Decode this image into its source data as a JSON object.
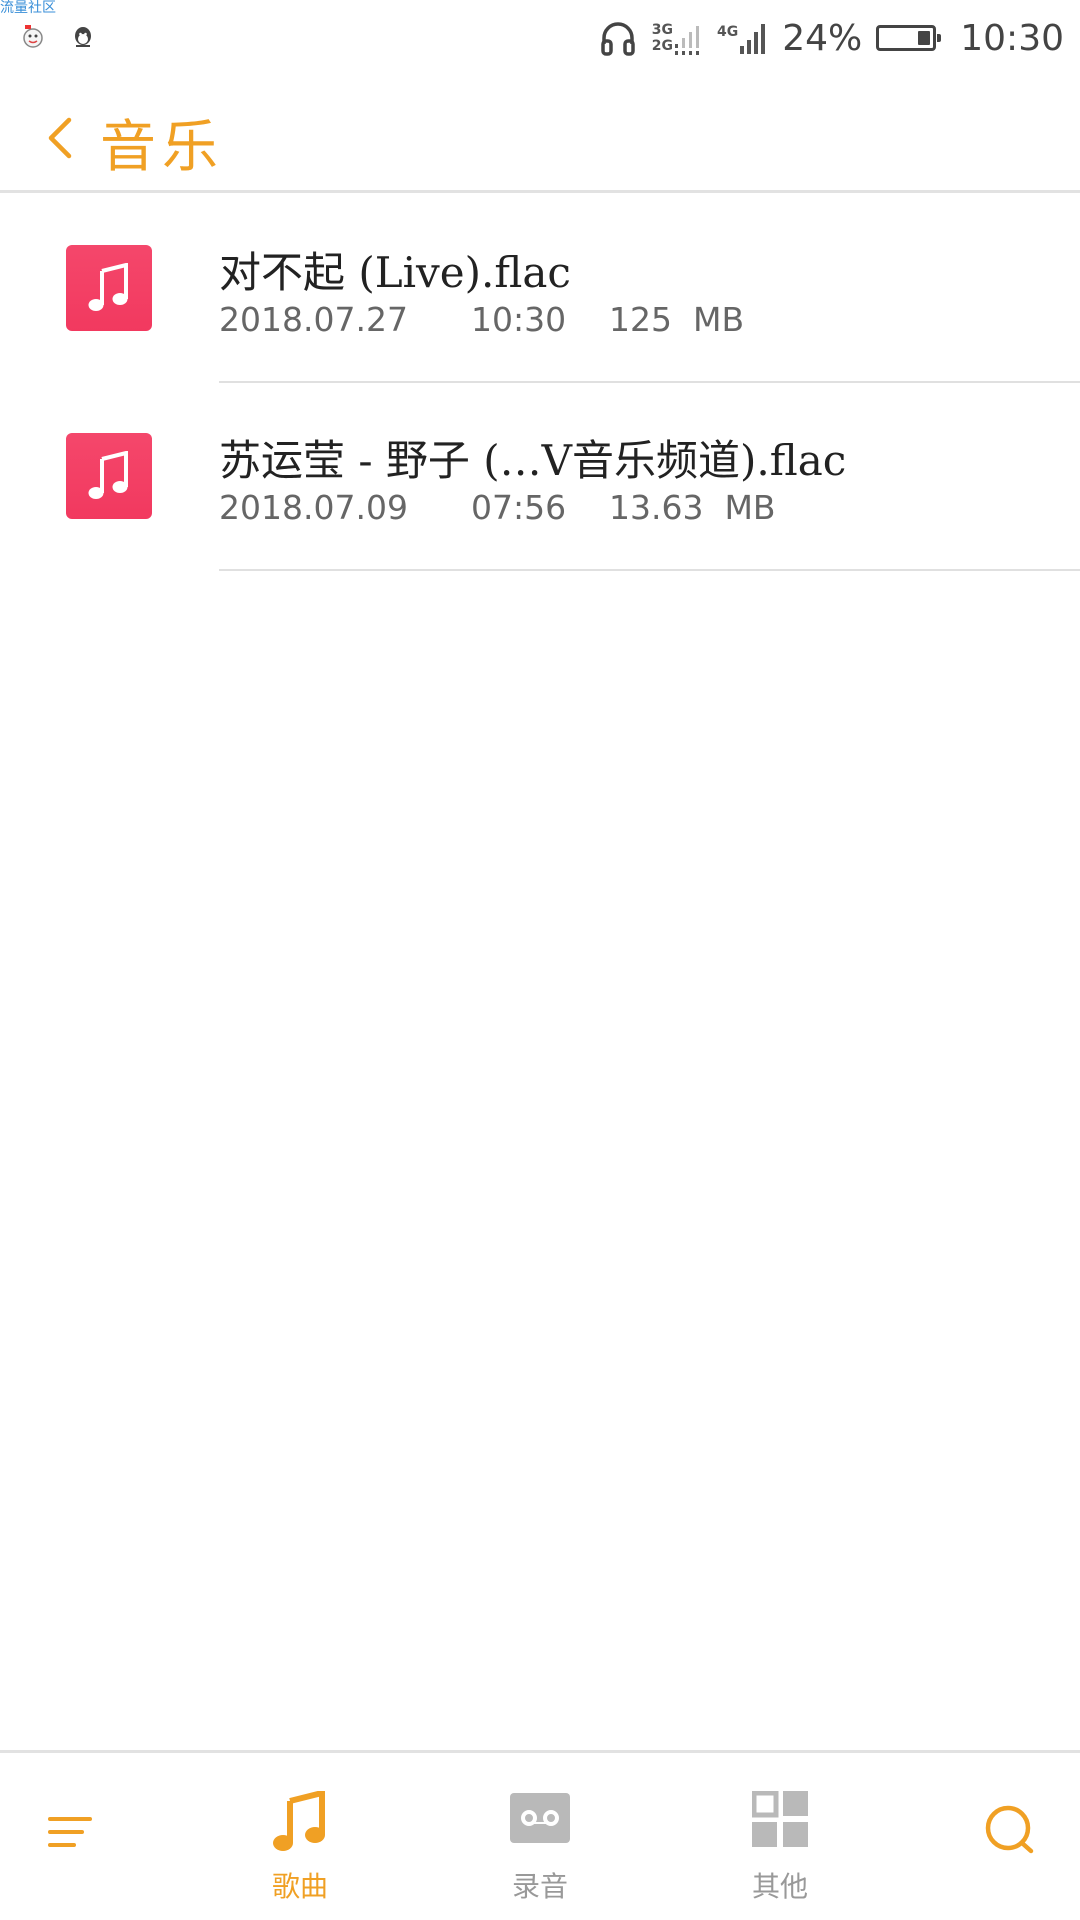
{
  "status_bar": {
    "watermark": "流量社区",
    "network_top": "3G",
    "network_bottom": "2G",
    "network_lte": "4G",
    "battery_percent": "24%",
    "battery_level": 0.24,
    "time": "10:30"
  },
  "header": {
    "title": "音乐"
  },
  "files": [
    {
      "name": "对不起 (Live).flac",
      "date": "2018.07.27",
      "time": "10:30",
      "size": "125  MB"
    },
    {
      "name": "苏运莹 - 野子 (…V音乐频道).flac",
      "date": "2018.07.09",
      "time": "07:56",
      "size": "13.63  MB"
    }
  ],
  "bottom_nav": {
    "songs": "歌曲",
    "recordings": "录音",
    "others": "其他"
  },
  "colors": {
    "accent": "#f0a024",
    "file_icon": "#f2395f",
    "inactive": "#999999"
  }
}
